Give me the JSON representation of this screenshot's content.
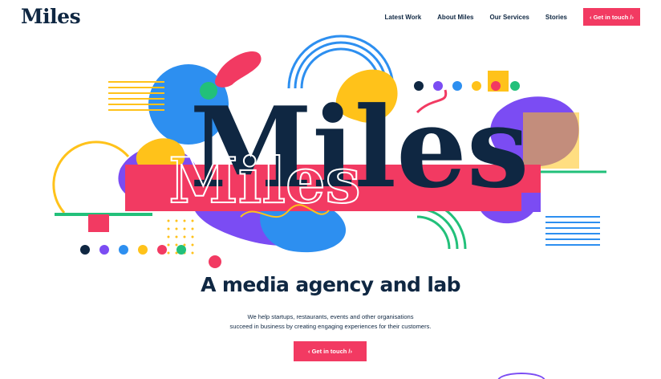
{
  "header": {
    "logo_text": "Miles",
    "nav": [
      {
        "label": "Latest Work"
      },
      {
        "label": "About Miles"
      },
      {
        "label": "Our Services"
      },
      {
        "label": "Stories"
      }
    ],
    "cta_label": "‹ Get in touch /›"
  },
  "hero": {
    "art_title": "Miles",
    "art_title_outline": "Miles",
    "headline": "A media agency and lab",
    "description_lines": [
      "We help startups, restaurants, events and other organisations",
      "succeed in business by creating engaging experiences for their customers."
    ],
    "cta_label": "‹ Get in touch /›"
  },
  "colors": {
    "navy": "#0f2742",
    "pink": "#f23a62",
    "blue": "#2d8ff0",
    "purple": "#7b4cf3",
    "yellow": "#ffc21a",
    "green": "#22c07a",
    "orange": "#ff7a45"
  }
}
